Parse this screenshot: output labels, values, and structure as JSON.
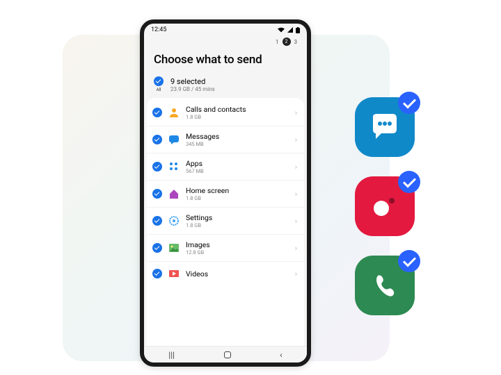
{
  "statusbar": {
    "time": "12:45"
  },
  "pager": {
    "steps": [
      "1",
      "2",
      "3"
    ],
    "current": 2
  },
  "header": {
    "title": "Choose what to send"
  },
  "select_all": {
    "all_label": "All",
    "main": "9 selected",
    "sub": "23.9 GB / 45 mins",
    "checked": true
  },
  "items": [
    {
      "title": "Calls and contacts",
      "sub": "1.8 GB",
      "icon": "contacts-icon",
      "checked": true
    },
    {
      "title": "Messages",
      "sub": "345 MB",
      "icon": "messages-icon",
      "checked": true
    },
    {
      "title": "Apps",
      "sub": "567 MB",
      "icon": "apps-icon",
      "checked": true
    },
    {
      "title": "Home screen",
      "sub": "1.8 GB",
      "icon": "home-icon",
      "checked": true
    },
    {
      "title": "Settings",
      "sub": "1.8 GB",
      "icon": "settings-icon",
      "checked": true
    },
    {
      "title": "Images",
      "sub": "12.8 GB",
      "icon": "images-icon",
      "checked": true
    },
    {
      "title": "Videos",
      "sub": "",
      "icon": "videos-icon",
      "checked": true
    }
  ],
  "side_icons": [
    {
      "name": "messages-app-icon",
      "checked": true
    },
    {
      "name": "camera-app-icon",
      "checked": true
    },
    {
      "name": "phone-app-icon",
      "checked": true
    }
  ],
  "colors": {
    "accent": "#1a73e8",
    "badge": "#2962ff",
    "messages": "#1089c9",
    "camera": "#e3193f",
    "phone": "#2d8a52"
  }
}
